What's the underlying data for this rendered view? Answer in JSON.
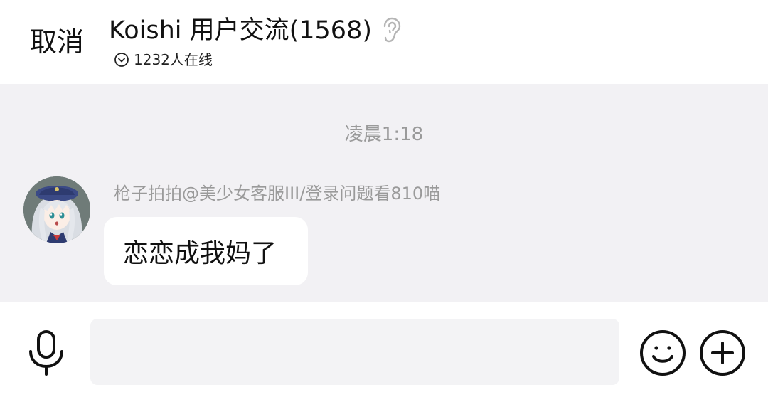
{
  "header": {
    "cancel_label": "取消",
    "title": "Koishi 用户交流(1568)",
    "online_text": "1232人在线"
  },
  "chat": {
    "timestamp": "凌晨1:18",
    "messages": [
      {
        "sender": "枪子拍拍@美少女客服III/登录问题看810喵",
        "text": "恋恋成我妈了"
      }
    ]
  },
  "input": {
    "value": "",
    "placeholder": ""
  },
  "icons": {
    "title_icon": "ear-icon",
    "online_icon": "chevron-circle-icon",
    "voice": "microphone-icon",
    "emoji": "smiley-icon",
    "more": "plus-circle-icon"
  },
  "colors": {
    "chat_background": "#f2f1f4",
    "bubble_background": "#ffffff",
    "secondary_text": "#9a9a9a"
  }
}
